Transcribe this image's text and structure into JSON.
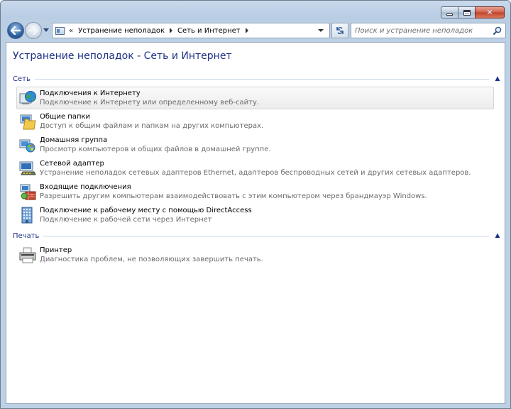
{
  "window": {
    "breadcrumb_prefix": "«",
    "breadcrumbs": [
      "Устранение неполадок",
      "Сеть и Интернет"
    ],
    "search_placeholder": "Поиск и устранение неполадок"
  },
  "page": {
    "title": "Устранение неполадок - Сеть и Интернет"
  },
  "groups": [
    {
      "title": "Сеть",
      "items": [
        {
          "title": "Подключения к Интернету",
          "desc": "Подключение к Интернету или определенному веб-сайту.",
          "icon": "internet-connection-icon"
        },
        {
          "title": "Общие папки",
          "desc": "Доступ к общим файлам и папкам на других компьютерах.",
          "icon": "shared-folders-icon"
        },
        {
          "title": "Домашняя группа",
          "desc": "Просмотр компьютеров и общих файлов в домашней группе.",
          "icon": "homegroup-icon"
        },
        {
          "title": "Сетевой адаптер",
          "desc": "Устранение неполадок сетевых адаптеров Ethernet, адаптеров беспроводных сетей и других сетевых адаптеров.",
          "icon": "network-adapter-icon"
        },
        {
          "title": "Входящие подключения",
          "desc": "Разрешить другим компьютерам взаимодействовать с этим компьютером через брандмауэр Windows.",
          "icon": "incoming-connections-icon"
        },
        {
          "title": "Подключение к рабочему месту с помощью DirectAccess",
          "desc": "Подключение к рабочей сети через Интернет",
          "icon": "directaccess-icon"
        }
      ]
    },
    {
      "title": "Печать",
      "items": [
        {
          "title": "Принтер",
          "desc": "Диагностика проблем, не позволяющих завершить печать.",
          "icon": "printer-icon"
        }
      ]
    }
  ],
  "colors": {
    "link_blue": "#1e3287",
    "desc_gray": "#6b6b6b",
    "frame": "#bcd0e6"
  }
}
